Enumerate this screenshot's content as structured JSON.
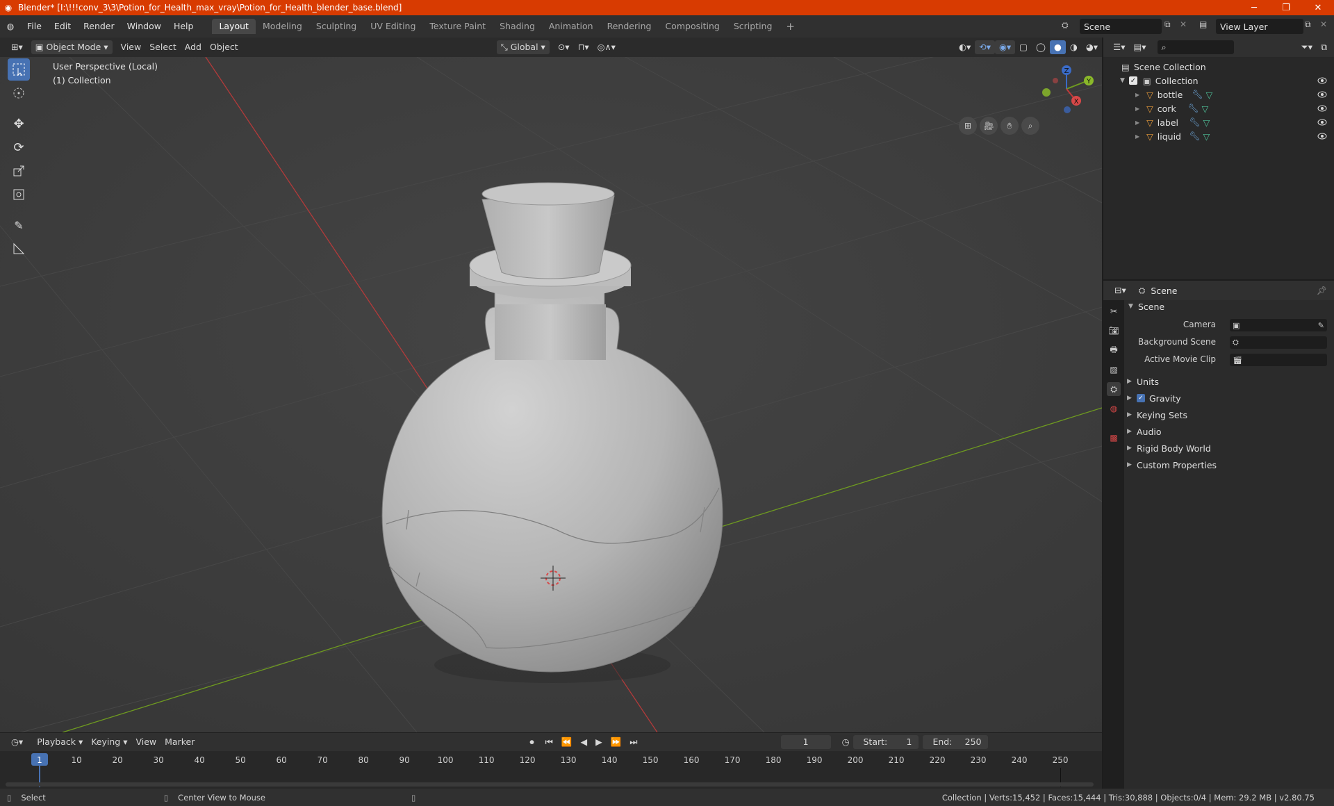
{
  "window": {
    "title": "Blender* [I:\\!!!conv_3\\3\\Potion_for_Health_max_vray\\Potion_for_Health_blender_base.blend]",
    "minimize": "─",
    "restore": "❐",
    "close": "✕"
  },
  "menu": [
    "File",
    "Edit",
    "Render",
    "Window",
    "Help"
  ],
  "workspaces": [
    "Layout",
    "Modeling",
    "Sculpting",
    "UV Editing",
    "Texture Paint",
    "Shading",
    "Animation",
    "Rendering",
    "Compositing",
    "Scripting"
  ],
  "active_workspace": "Layout",
  "scene_field": "Scene",
  "view_layer_field": "View Layer",
  "viewport_header": {
    "mode": "Object Mode",
    "menus": [
      "View",
      "Select",
      "Add",
      "Object"
    ],
    "orientation": "Global"
  },
  "viewport": {
    "perspective": "User Perspective (Local)",
    "collection": "(1) Collection",
    "gizmo": {
      "z": "Z",
      "y": "Y",
      "x": "X"
    }
  },
  "outliner": {
    "root": "Scene Collection",
    "collection": "Collection",
    "objects": [
      "bottle",
      "cork",
      "label",
      "liquid"
    ]
  },
  "properties": {
    "header": "Scene",
    "section": "Scene",
    "camera_label": "Camera",
    "background_scene_label": "Background Scene",
    "active_movie_clip_label": "Active Movie Clip",
    "panels": [
      "Units",
      "Gravity",
      "Keying Sets",
      "Audio",
      "Rigid Body World",
      "Custom Properties"
    ],
    "gravity_checked": true
  },
  "timeline": {
    "menus": [
      "Playback",
      "Keying",
      "View",
      "Marker"
    ],
    "current_frame": "1",
    "start_label": "Start:",
    "start": "1",
    "end_label": "End:",
    "end": "250",
    "ticks": [
      "1",
      "10",
      "20",
      "30",
      "40",
      "50",
      "60",
      "70",
      "80",
      "90",
      "100",
      "110",
      "120",
      "130",
      "140",
      "150",
      "160",
      "170",
      "180",
      "190",
      "200",
      "210",
      "220",
      "230",
      "240",
      "250"
    ]
  },
  "statusbar": {
    "left": "Select",
    "middle": "Center View to Mouse",
    "stats": "Collection | Verts:15,452 | Faces:15,444 | Tris:30,888 | Objects:0/4 | Mem: 29.2 MB | v2.80.75"
  },
  "colors": {
    "titlebar": "#d83b01",
    "active_blue": "#4772b3",
    "x_axis": "#c23a3a",
    "y_axis": "#6e9a20",
    "object_orange": "#e89b3a"
  }
}
